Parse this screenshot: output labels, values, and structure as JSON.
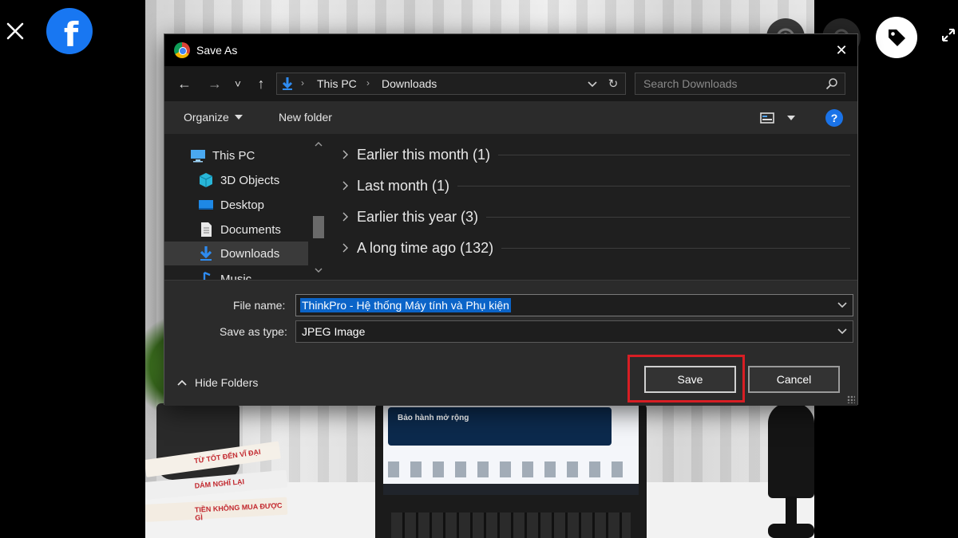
{
  "viewer": {
    "icons": {
      "close": "close-icon",
      "brand": "facebook-logo-icon",
      "tag": "tag-icon",
      "expand": "expand-icon"
    },
    "brand_letter": "f",
    "brand_color": "#1877f2"
  },
  "photo": {
    "book_titles": [
      "TỪ TỐT ĐẾN VĨ ĐẠI",
      "DÁM NGHĨ LẠI",
      "TIỀN KHÔNG MUA ĐƯỢC GÌ"
    ],
    "screen_banner": "Bảo hành mở rộng"
  },
  "dialog": {
    "title": "Save As",
    "close_glyph": "✕",
    "nav": {
      "back": "←",
      "forward": "→",
      "recent": "˅",
      "up": "↑"
    },
    "address": {
      "crumbs": [
        "This PC",
        "Downloads"
      ],
      "separator": "›",
      "refresh": "↻"
    },
    "search": {
      "placeholder": "Search Downloads"
    },
    "toolbar": {
      "organize": "Organize",
      "new_folder": "New folder",
      "help": "?"
    },
    "nav_pane": {
      "items": [
        {
          "label": "This PC",
          "icon": "computer-icon"
        },
        {
          "label": "3D Objects",
          "icon": "3d-objects-icon"
        },
        {
          "label": "Desktop",
          "icon": "desktop-icon"
        },
        {
          "label": "Documents",
          "icon": "documents-icon"
        },
        {
          "label": "Downloads",
          "icon": "downloads-icon",
          "selected": true
        },
        {
          "label": "Music",
          "icon": "music-icon"
        }
      ]
    },
    "groups": [
      {
        "label": "Earlier this month (1)"
      },
      {
        "label": "Last month (1)"
      },
      {
        "label": "Earlier this year (3)"
      },
      {
        "label": "A long time ago (132)"
      }
    ],
    "form": {
      "file_name_label": "File name:",
      "file_name_value": "ThinkPro - Hệ thống Máy tính và Phụ kiện",
      "save_type_label": "Save as type:",
      "save_type_value": "JPEG Image",
      "hide_folders": "Hide Folders",
      "save": "Save",
      "cancel": "Cancel"
    },
    "accent_color": "#0b64c8",
    "highlight_color": "#d81e24"
  }
}
